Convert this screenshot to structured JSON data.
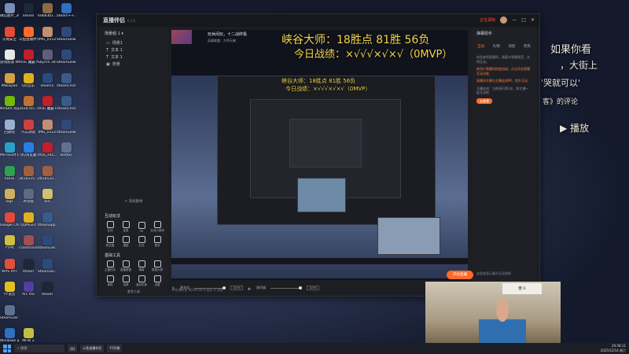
{
  "desktop": {
    "icons": [
      {
        "label": "微信图片_20250408...",
        "color": "#7a8fb4"
      },
      {
        "label": "Steam",
        "color": "#1b2838"
      },
      {
        "label": "6db83b1...",
        "color": "#8b6b45"
      },
      {
        "label": "Steam++.exe",
        "color": "#3070c0"
      },
      {
        "label": "火绒安全",
        "color": "#e84a3a"
      },
      {
        "label": "斗鱼直播伴侣",
        "color": "#ff6a2b"
      },
      {
        "label": "IMG_0312",
        "color": "#c09070"
      },
      {
        "label": "SteamDownload",
        "color": "#2d4a7a"
      },
      {
        "label": "游戏加速 WeGame",
        "color": "#e8e8e8"
      },
      {
        "label": "ROG 魔霸 ACE HRV",
        "color": "#c0202a"
      },
      {
        "label": "Skyrim 18.sln",
        "color": "#5f5f7a"
      },
      {
        "label": "SteamDownload",
        "color": "#2d4a7a"
      },
      {
        "label": "PNkaiJian",
        "color": "#d4a040"
      },
      {
        "label": "QQ音乐",
        "color": "#e0b020"
      },
      {
        "label": "steam5",
        "color": "#2a4a7a"
      },
      {
        "label": "steamcmd",
        "color": "#3a5a8a"
      },
      {
        "label": "NVIDIA App",
        "color": "#76b900"
      },
      {
        "label": "3a587b5...",
        "color": "#c07030"
      },
      {
        "label": "ROG 魔霸 HRV",
        "color": "#c0202a"
      },
      {
        "label": "steamcmd",
        "color": "#3a5a8a"
      },
      {
        "label": "回收站",
        "color": "#9ab0d0"
      },
      {
        "label": "汽车测试",
        "color": "#d04040"
      },
      {
        "label": "IMG_0312",
        "color": "#c09070"
      },
      {
        "label": "SteamDownload",
        "color": "#2d4a7a"
      },
      {
        "label": "Microsoft Edge",
        "color": "#2aa0c8"
      },
      {
        "label": "QQ浏览器",
        "color": "#2a80e0"
      },
      {
        "label": "ROG_HLC...",
        "color": "#c0202a"
      },
      {
        "label": "lastfps",
        "color": "#607090"
      },
      {
        "label": "XDDE",
        "color": "#30a050"
      },
      {
        "label": "2b1b535...",
        "color": "#a06040"
      },
      {
        "label": "2b1b535...",
        "color": "#a06040"
      },
      {
        "label": "",
        "color": "transparent"
      },
      {
        "label": "logs",
        "color": "#d0b060"
      },
      {
        "label": "冰雪版",
        "color": "#606a80"
      },
      {
        "label": "Bin",
        "color": "#d0c070"
      },
      {
        "label": "",
        "color": "transparent"
      },
      {
        "label": "Google Chrome",
        "color": "#e04a3a"
      },
      {
        "label": "QQMusic",
        "color": "#e0b020"
      },
      {
        "label": "steamapp...",
        "color": "#3a5a8a"
      },
      {
        "label": "",
        "color": "transparent"
      },
      {
        "label": "YYPR",
        "color": "#d0c040"
      },
      {
        "label": "crashhandl...",
        "color": "#a05050"
      },
      {
        "label": "steamclie...",
        "color": "#2a4a7a"
      },
      {
        "label": "",
        "color": "transparent"
      },
      {
        "label": "WPS PPT",
        "color": "#e0503a"
      },
      {
        "label": "steam",
        "color": "#1b2838"
      },
      {
        "label": "SteamDo...",
        "color": "#2d4a7a"
      },
      {
        "label": "",
        "color": "transparent"
      },
      {
        "label": "YY语音",
        "color": "#e0c020"
      },
      {
        "label": "Arc Pro",
        "color": "#5040a0"
      },
      {
        "label": "steam",
        "color": "#1b2838"
      },
      {
        "label": "",
        "color": "transparent"
      },
      {
        "label": "SteamLibr...",
        "color": "#607090"
      },
      {
        "label": "",
        "color": "transparent"
      },
      {
        "label": "",
        "color": "transparent"
      },
      {
        "label": "",
        "color": "transparent"
      },
      {
        "label": "Windows 安全中心",
        "color": "#3070c0"
      },
      {
        "label": "MFW 2",
        "color": "#c0c040"
      },
      {
        "label": "",
        "color": "transparent"
      },
      {
        "label": "",
        "color": "transparent"
      }
    ]
  },
  "background_text": {
    "line1": "如果你看",
    "line2": "，大街上",
    "line3": "'哭就可以'",
    "line4": "客》的评论",
    "play": "播放"
  },
  "app": {
    "logo": "直播伴侣",
    "version": "6.3.0",
    "top_right": {
      "record": "正在录制",
      "item1": "开播设置",
      "item2": "分享",
      "item3": "万能"
    },
    "window_buttons": [
      "—",
      "□",
      "✕"
    ],
    "left_panel": {
      "header": "场景组 1",
      "scenes": [
        "场景1",
        "文本 1",
        "文本 1",
        "背景"
      ],
      "add_source": "+ 添加素材",
      "interactive_title": "互动玩法",
      "interactive_tools": [
        "互动",
        "连麦",
        "PK",
        "互动小游戏",
        "粉丝团",
        "福袋",
        "红包",
        "更多"
      ],
      "basic_title": "基础工具",
      "basic_tools": [
        "主播任务",
        "直播数据",
        "弹幕",
        "数据大屏",
        "美颜",
        "录屏",
        "虚拟形象",
        "设置"
      ],
      "more": "更多工具"
    },
    "preview": {
      "stream_title": "玩休闲玩，十二战终极",
      "sub": "英雄联盟 · 大师天梯",
      "overlay_line1": "峡谷大师：18胜点    81胜 56负",
      "overlay_line2": "今日战绩：×√√√×√×√（0MVP）"
    },
    "right_panel": {
      "header": "弹幕助手",
      "tabs": [
        "互动",
        "礼物",
        "消息",
        "贵宾"
      ],
      "notes": [
        "欢迎来到直播间，请遵守直播规范，文明互动。",
        "新用户直播间热度加成，点击开启直播互动功能",
        "直播间主播与主播连线PK，提升互动",
        "主播连线：当前排行第1名，和主播一起互动吧"
      ],
      "button": "去查看",
      "footer": "这里会显示观众互动消息"
    },
    "bottom_bar": {
      "mic_label": "麦克风",
      "mic_pct": "100%",
      "speaker_label": "扬声器",
      "speaker_pct": "100%",
      "status": "◇ 在线时长 00:00:00  0 观众  0 点赞",
      "go_live": "开始直播"
    }
  },
  "webcam": {
    "sign": "奋斗"
  },
  "taskbar": {
    "search": "搜索",
    "tasks": [
      "QQ",
      "斗鱼直播伴侣",
      "YY开播"
    ],
    "time": "20:58:11",
    "date": "2025/12/14 周六"
  }
}
